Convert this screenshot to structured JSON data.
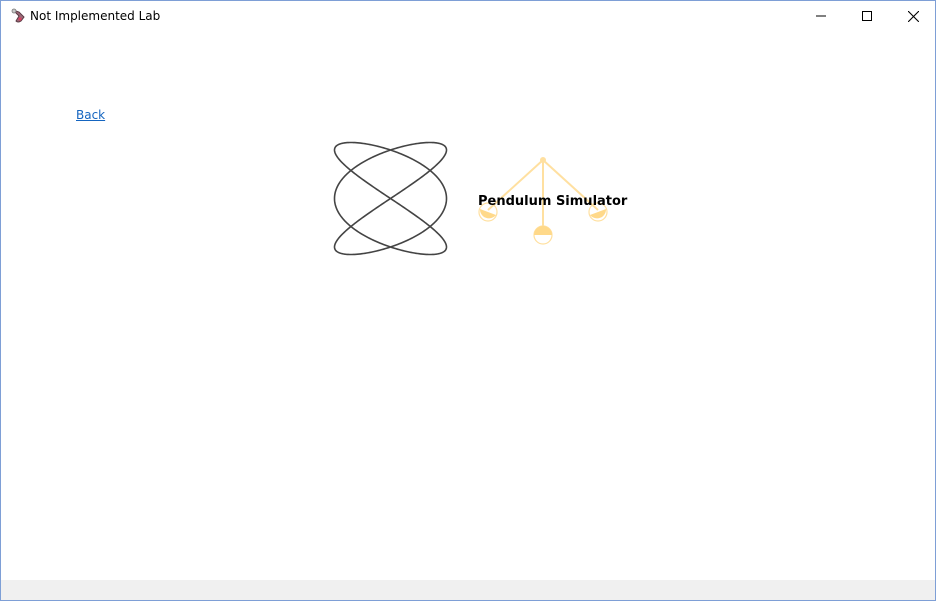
{
  "window": {
    "title": "Not Implemented Lab",
    "icons": {
      "app": "flask-icon",
      "minimize": "minimize-icon",
      "maximize": "maximize-icon",
      "close": "close-icon"
    }
  },
  "nav": {
    "back_label": "Back"
  },
  "tiles": [
    {
      "icon": "lissajous-curve-icon",
      "label": ""
    },
    {
      "icon": "pendulum-icon",
      "label": "Pendulum Simulator"
    }
  ],
  "colors": {
    "accent_link": "#1565c0",
    "pendulum": "#ffe0a0",
    "curve": "#444444",
    "statusbar": "#f0f0f0",
    "window_border": "#7e9fd6"
  }
}
